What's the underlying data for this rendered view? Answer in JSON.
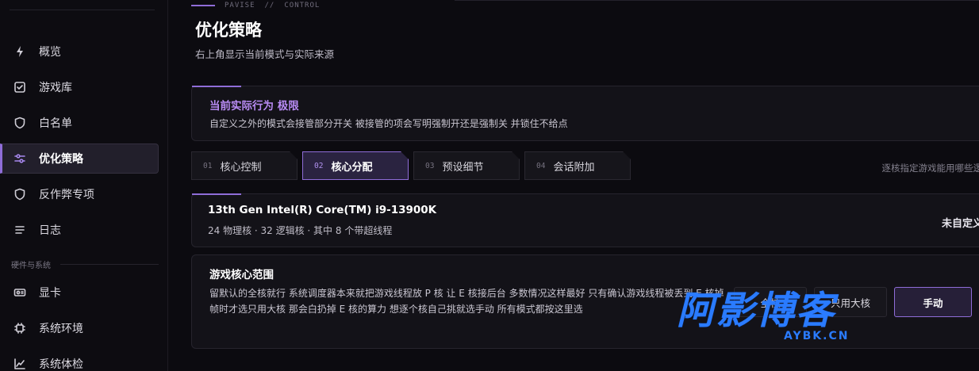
{
  "sidebar": {
    "items": [
      {
        "label": "概览",
        "icon": "bolt-icon"
      },
      {
        "label": "游戏库",
        "icon": "checkbox-icon"
      },
      {
        "label": "白名单",
        "icon": "shield-icon"
      },
      {
        "label": "优化策略",
        "icon": "sliders-icon",
        "active": true
      },
      {
        "label": "反作弊专项",
        "icon": "shield-icon"
      },
      {
        "label": "日志",
        "icon": "list-icon"
      }
    ],
    "section_label": "硬件与系统",
    "hardware_items": [
      {
        "label": "显卡",
        "icon": "gpu-icon"
      },
      {
        "label": "系统环境",
        "icon": "chip-icon"
      },
      {
        "label": "系统体检",
        "icon": "chart-line-icon"
      }
    ]
  },
  "header": {
    "eyebrow_left": "PAVISE",
    "eyebrow_sep": "//",
    "eyebrow_right": "CONTROL",
    "title": "优化策略",
    "subtitle": "右上角显示当前模式与实际来源"
  },
  "current_behavior": {
    "title": "当前实际行为 极限",
    "description": "自定义之外的模式会接管部分开关 被接管的项会写明强制开还是强制关 并锁住不给点"
  },
  "tabs": [
    {
      "num": "01",
      "label": "核心控制"
    },
    {
      "num": "02",
      "label": "核心分配",
      "active": true
    },
    {
      "num": "03",
      "label": "预设细节"
    },
    {
      "num": "04",
      "label": "会话附加"
    }
  ],
  "tabs_note": "逐核指定游戏能用哪些逻",
  "cpu": {
    "name": "13th Gen Intel(R) Core(TM) i9-13900K",
    "info": "24 物理核 · 32 逻辑核 · 其中 8 个带超线程",
    "status": "未自定义"
  },
  "core_range": {
    "title": "游戏核心范围",
    "description": "留默认的全核就行 系统调度器本来就把游戏线程放 P 核 让 E 核接后台 多数情况这样最好 只有确认游戏线程被丢到 E 核掉帧时才选只用大核 那会白扔掉 E 核的算力 想逐个核自己挑就选手动 所有模式都按这里选",
    "options": [
      "全核",
      "只用大核",
      "手动"
    ],
    "selected": "手动"
  },
  "watermark": {
    "main": "阿影博客",
    "sub": "AYBK.CN"
  },
  "colors": {
    "accent": "#8f6dd8",
    "accent_text": "#b98cf5",
    "background": "#0c0b10",
    "panel": "#131218",
    "watermark_blue": "#2a7bff"
  }
}
